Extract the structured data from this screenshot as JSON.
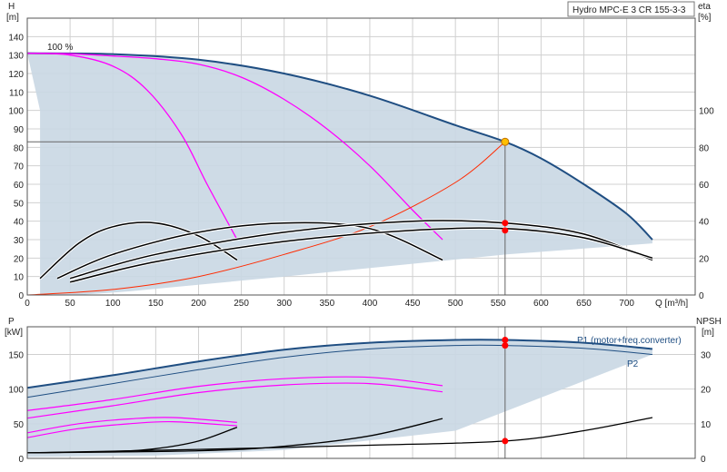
{
  "pump_title": "Hydro MPC-E 3 CR 155-3-3",
  "colors": {
    "envelope_fill": "#c9d7e3",
    "envelope_edge": "#1f4e82",
    "speed_curve": "#ff00ff",
    "efficiency": "#000000",
    "system_curve": "#ff2a00",
    "duty_point": "#ffbf00",
    "marker": "#ff0000",
    "grid": "#d0d0d0"
  },
  "top_chart": {
    "y_label": "H",
    "y_unit": "[m]",
    "right_label": "eta",
    "right_unit": "[%]",
    "x_label": "Q [m³/h]",
    "speed_label": "100 %",
    "x_ticks": [
      0,
      50,
      100,
      150,
      200,
      250,
      300,
      350,
      400,
      450,
      500,
      550,
      600,
      650,
      700
    ],
    "y_ticks": [
      0,
      10,
      20,
      30,
      40,
      50,
      60,
      70,
      80,
      90,
      100,
      110,
      120,
      130,
      140
    ],
    "eta_ticks": [
      0,
      20,
      40,
      60,
      80,
      100
    ]
  },
  "bottom_chart": {
    "y_label": "P",
    "y_unit": "[kW]",
    "right_label": "NPSH",
    "right_unit": "[m]",
    "p1_label": "P1 (motor+freq.converter)",
    "p2_label": "P2",
    "y_ticks": [
      0,
      50,
      100,
      150
    ],
    "npsh_ticks": [
      0,
      10,
      20,
      30
    ]
  },
  "chart_data": [
    {
      "type": "line",
      "title": "Hydro MPC-E 3 CR 155-3-3",
      "xlabel": "Q [m³/h]",
      "ylabel": "H [m]",
      "y2label": "eta [%]",
      "xlim": [
        0,
        780
      ],
      "ylim": [
        0,
        150
      ],
      "y2lim": [
        0,
        150
      ],
      "grid": true,
      "duty_point": {
        "x": 558,
        "y": 83
      },
      "series": [
        {
          "name": "100 %",
          "axis": "H",
          "x": [
            0,
            100,
            200,
            300,
            400,
            500,
            558,
            600,
            650,
            700,
            730
          ],
          "y": [
            131,
            130.5,
            127.5,
            120,
            108,
            92,
            83,
            74,
            60,
            44,
            30
          ]
        },
        {
          "axis": "H",
          "x": [
            0,
            50,
            100,
            150,
            200,
            250,
            300,
            350,
            400,
            450,
            485
          ],
          "y": [
            131,
            130.7,
            129.5,
            128,
            125,
            118,
            106,
            90,
            70,
            46,
            30
          ]
        },
        {
          "axis": "H",
          "x": [
            0,
            50,
            100,
            140,
            180,
            210,
            245
          ],
          "y": [
            131,
            130,
            124,
            111,
            87,
            60,
            30
          ]
        },
        {
          "axis": "H",
          "x": [
            0,
            100,
            200,
            300,
            400,
            500,
            558
          ],
          "y": [
            0,
            3,
            10,
            22,
            37,
            61,
            83
          ]
        },
        {
          "axis": "eta",
          "x": [
            15,
            60,
            100,
            150,
            200,
            245
          ],
          "y": [
            9,
            28,
            37,
            39,
            32,
            19
          ]
        },
        {
          "axis": "eta",
          "x": [
            35,
            100,
            200,
            300,
            400,
            485
          ],
          "y": [
            9,
            22,
            34,
            39,
            36,
            19
          ]
        },
        {
          "axis": "eta",
          "x": [
            50,
            150,
            300,
            450,
            558,
            650,
            730
          ],
          "y": [
            9,
            22,
            34,
            40,
            39,
            33,
            19
          ]
        },
        {
          "axis": "eta",
          "x": [
            50,
            150,
            300,
            450,
            558,
            650,
            730
          ],
          "y": [
            7,
            18,
            29,
            35,
            36,
            31,
            20
          ]
        }
      ],
      "markers": [
        {
          "axis": "H",
          "x": 558,
          "y": 83
        },
        {
          "axis": "eta",
          "x": 558,
          "y": 39
        },
        {
          "axis": "eta",
          "x": 558,
          "y": 35
        }
      ]
    },
    {
      "type": "line",
      "xlabel": "Q [m³/h]",
      "ylabel": "P [kW]",
      "y2label": "NPSH [m]",
      "xlim": [
        0,
        780
      ],
      "ylim": [
        0,
        190
      ],
      "y2lim": [
        0,
        38
      ],
      "grid": true,
      "series": [
        {
          "name": "P1 (motor+freq.converter)",
          "axis": "P",
          "x": [
            0,
            100,
            200,
            300,
            400,
            500,
            558,
            650,
            730
          ],
          "y": [
            102,
            120,
            140,
            157,
            167,
            171,
            171,
            167,
            158
          ]
        },
        {
          "name": "P2",
          "axis": "P",
          "x": [
            0,
            100,
            200,
            300,
            400,
            500,
            558,
            650,
            730
          ],
          "y": [
            88,
            108,
            128,
            146,
            158,
            163,
            163,
            159,
            150
          ]
        },
        {
          "axis": "P",
          "x": [
            0,
            100,
            200,
            300,
            400,
            485
          ],
          "y": [
            69,
            85,
            104,
            115,
            117,
            105
          ]
        },
        {
          "axis": "P",
          "x": [
            0,
            100,
            200,
            300,
            400,
            485
          ],
          "y": [
            58,
            76,
            95,
            106,
            108,
            96
          ]
        },
        {
          "axis": "P",
          "x": [
            0,
            60,
            120,
            170,
            245
          ],
          "y": [
            37,
            50,
            57,
            59,
            52
          ]
        },
        {
          "axis": "P",
          "x": [
            0,
            60,
            120,
            170,
            245
          ],
          "y": [
            30,
            43,
            50,
            53,
            47
          ]
        },
        {
          "axis": "NPSH",
          "x": [
            0,
            100,
            150,
            200,
            245
          ],
          "y": [
            1.6,
            2,
            2.8,
            5,
            9
          ]
        },
        {
          "axis": "NPSH",
          "x": [
            0,
            200,
            300,
            400,
            485
          ],
          "y": [
            1.6,
            2.2,
            3.5,
            6.5,
            11.5
          ]
        },
        {
          "axis": "NPSH",
          "x": [
            0,
            200,
            400,
            558,
            650,
            730
          ],
          "y": [
            1.6,
            2.6,
            3.8,
            5,
            8,
            11.8
          ]
        }
      ],
      "markers": [
        {
          "axis": "P",
          "x": 558,
          "y": 171
        },
        {
          "axis": "P",
          "x": 558,
          "y": 163
        },
        {
          "axis": "NPSH",
          "x": 558,
          "y": 5
        }
      ]
    }
  ]
}
